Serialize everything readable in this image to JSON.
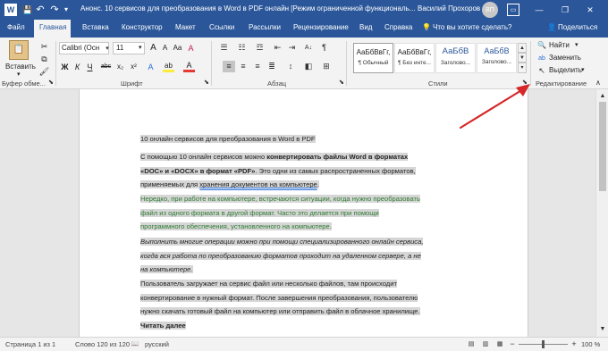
{
  "title": {
    "document": "Анонс. 10 сервисов для преобразования в Word в PDF онлайн [Режим ограниченной функциональ...",
    "user": "Василий Прохоров",
    "avatar_initials": "ВП",
    "minimize": "—",
    "restore": "❐",
    "close": "✕"
  },
  "quick_access": {
    "save": "💾",
    "undo": "↶",
    "redo": "↷",
    "customize": "▾"
  },
  "menu": {
    "tabs": [
      "Файл",
      "Главная",
      "Вставка",
      "Конструктор",
      "Макет",
      "Ссылки",
      "Рассылки",
      "Рецензирование",
      "Вид",
      "Справка"
    ],
    "tell_me_icon": "💡",
    "tell_me": "Что вы хотите сделать?",
    "share_icon": "👤",
    "share": "Поделиться"
  },
  "ribbon": {
    "clipboard": {
      "paste": "Вставить",
      "paste_arrow": "▾",
      "cut": "✂",
      "copy": "⧉",
      "format_painter": "🖌",
      "group": "Буфер обме..."
    },
    "font": {
      "font_name": "Calibri (Осн",
      "font_size": "11",
      "grow": "A",
      "shrink": "A",
      "case": "Aa",
      "clear": "A",
      "bold": "Ж",
      "italic": "К",
      "underline": "Ч",
      "strike": "abc",
      "subscript": "x₂",
      "superscript": "x²",
      "effects": "A",
      "highlight": "ab",
      "color": "A",
      "group": "Шрифт"
    },
    "paragraph": {
      "group": "Абзац",
      "sort": "A↓",
      "show_marks": "¶"
    },
    "styles": {
      "items": [
        {
          "preview": "АаБбВвГг,",
          "name": "¶ Обычный"
        },
        {
          "preview": "АаБбВвГг,",
          "name": "¶ Без инте..."
        },
        {
          "preview": "АаБбВ",
          "name": "Заголово..."
        },
        {
          "preview": "АаБбВ",
          "name": "Заголово..."
        }
      ],
      "group": "Стили"
    },
    "editing": {
      "find_icon": "🔍",
      "find": "Найти",
      "replace_icon": "ab",
      "replace": "Заменить",
      "select_icon": "↖",
      "select": "Выделить",
      "group": "Редактирование"
    }
  },
  "document": {
    "heading": "10 онлайн сервисов для преобразования в Word в PDF",
    "p1_a": "С помощью 10 онлайн сервисов можно ",
    "p1_b": "конвертировать файлы Word в форматах «DOC» и «DOCX» в формат «PDF»",
    "p1_c": ". Это одни из самых распространенных форматов, применяемых для ",
    "p1_d": "хранения документов на компьютере",
    "p1_e": ".",
    "p2": "Нередко, при работе на компьютере, встречаются ситуации, когда нужно преобразовать файл из одного формата в другой формат. Часто это делается при помощи программного обеспечения, установленного на компьютере.",
    "p3": "Выполнить многие операции можно при помощи специализированного онлайн сервиса, когда вся работа по преобразованию форматов проходит на удаленном сервере, а не на компьютере.",
    "p4": "Пользователь загружает на сервис файл или несколько файлов, там происходит конвертирование в нужный формат. После завершения преобразования, пользователю нужно скачать готовый файл на компьютер или отправить файл в облачное хранилище.",
    "read_more": "Читать далее"
  },
  "status": {
    "page": "Страница 1 из 1",
    "words": "Слово 120 из 120",
    "language": "русский",
    "zoom_minus": "−",
    "zoom_plus": "+",
    "zoom": "100 %",
    "zoom_fraction": 1.0
  },
  "colors": {
    "accent": "#2b579a",
    "highlight": "#d6d6d6",
    "green_text": "#2e7d32",
    "arrow": "#d62828"
  }
}
